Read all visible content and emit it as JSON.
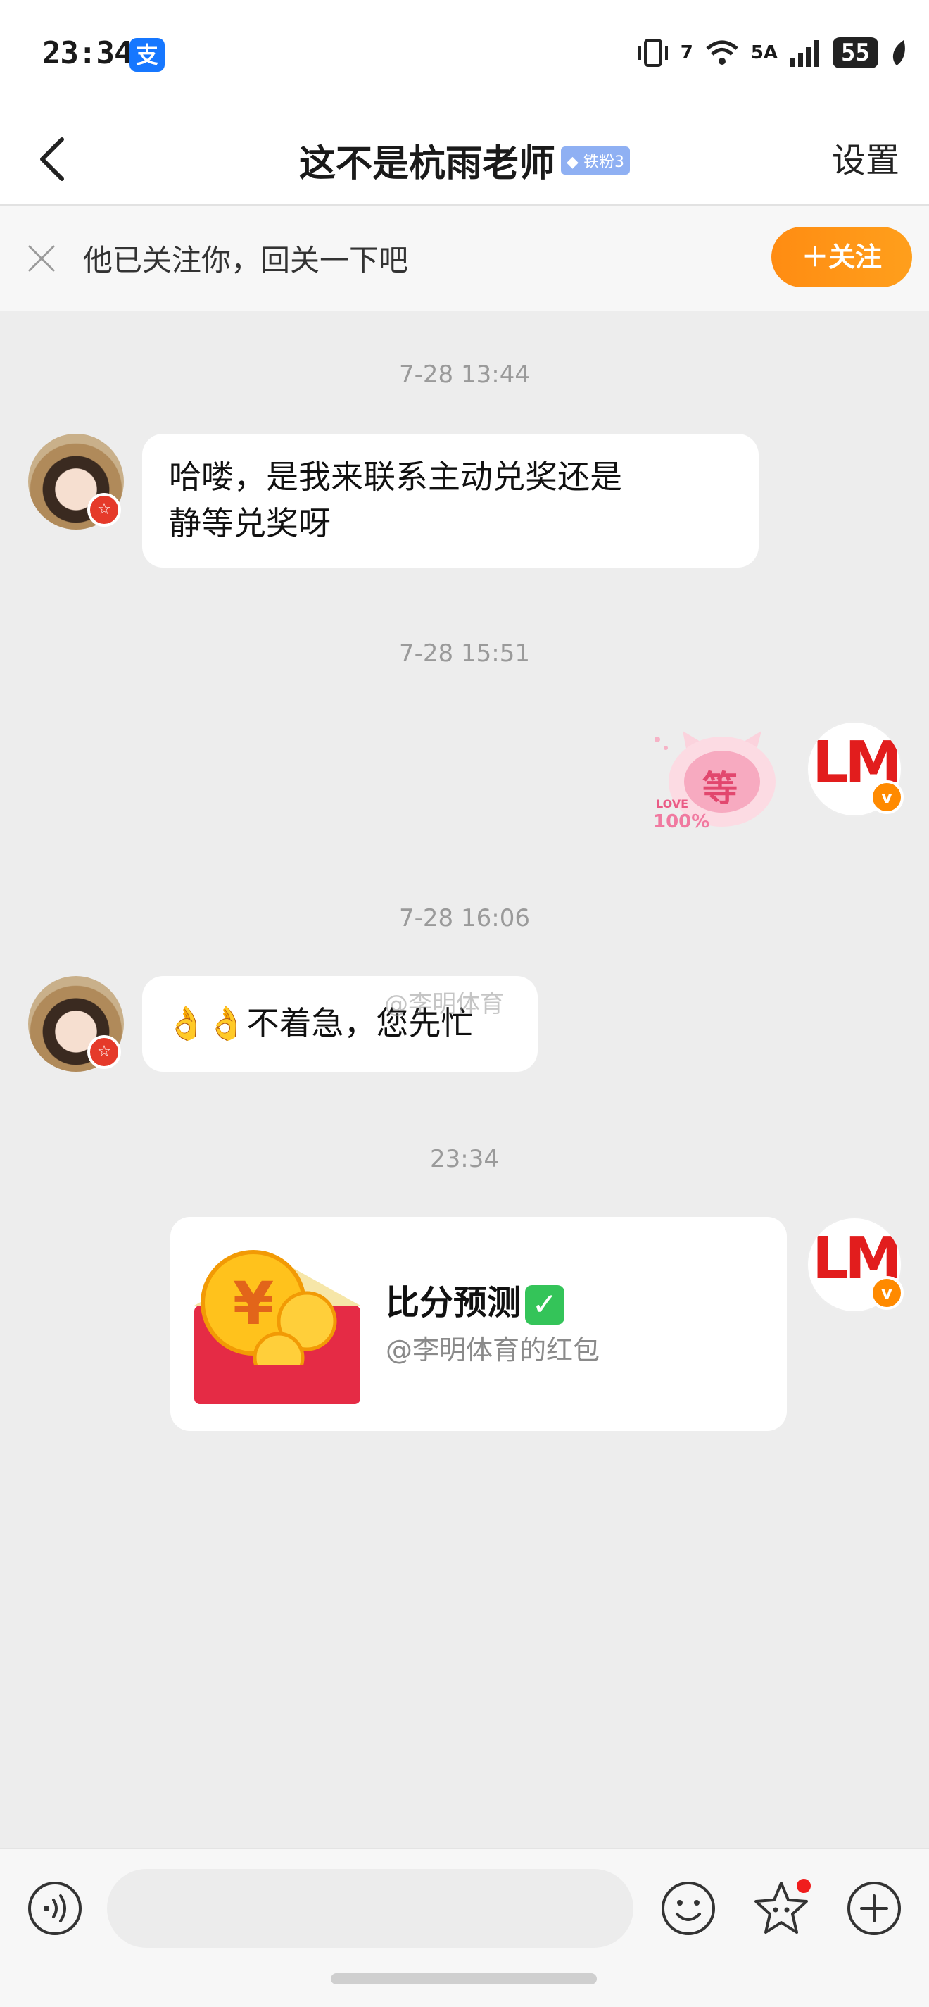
{
  "status_bar": {
    "time": "23:34",
    "alipay_icon": "支",
    "network_label": "5A",
    "wifi_label": "7",
    "battery_level": "55"
  },
  "nav": {
    "title": "这不是杭雨老师",
    "fan_badge": "铁粉3",
    "settings_label": "设置"
  },
  "follow_prompt": {
    "text": "他已关注你，回关一下吧",
    "button_label": "＋关注"
  },
  "messages": [
    {
      "timestamp": "7-28 13:44",
      "sender": "other",
      "text_line1": "哈喽，是我来联系主动兑奖还是",
      "text_line2": "静等兑奖呀"
    },
    {
      "timestamp": "7-28 15:51",
      "sender": "me",
      "sticker_text": "等",
      "sticker_small1": "LOVE",
      "sticker_small2": "100%"
    },
    {
      "timestamp": "7-28 16:06",
      "sender": "other",
      "text": "👌👌不着急，您先忙"
    },
    {
      "timestamp": "23:34",
      "sender": "me",
      "card_title": "比分预测",
      "card_subtitle": "@李明体育的红包"
    }
  ],
  "watermark": "@李明体育",
  "avatars": {
    "other_badge": "☆",
    "me_badge": "v",
    "me_logo": "LM"
  },
  "icons": {
    "back": "chevron-left-icon",
    "close": "close-icon",
    "voice": "voice-icon",
    "emoji": "emoji-icon",
    "star": "star-icon",
    "plus": "plus-icon"
  },
  "colors": {
    "accent": "#ff9416",
    "badge_blue": "#8fb0f3",
    "red_packet": "#e52b45",
    "check_green": "#34c459"
  }
}
